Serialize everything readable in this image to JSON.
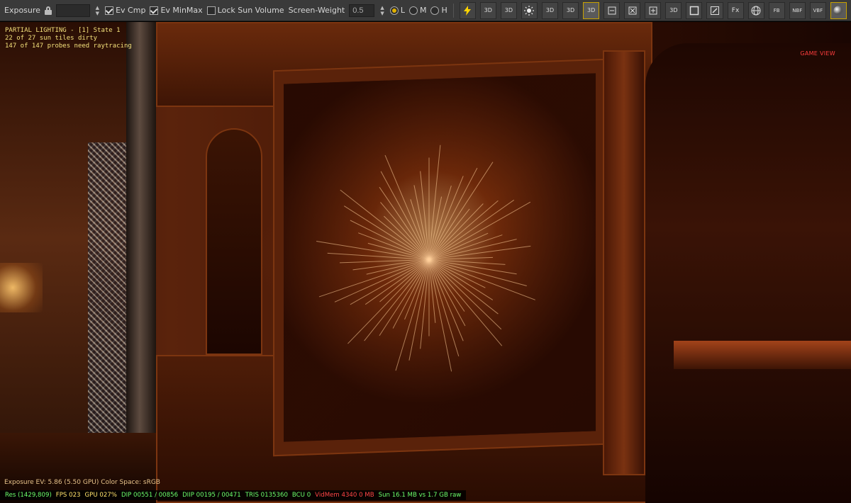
{
  "toolbar": {
    "exposure_label": "Exposure",
    "ev_cmp_label": "Ev Cmp",
    "ev_cmp_checked": true,
    "ev_minmax_label": "Ev MinMax",
    "ev_minmax_checked": true,
    "lock_sun_volume_label": "Lock Sun Volume",
    "lock_sun_volume_checked": false,
    "screen_weight_label": "Screen-Weight",
    "screen_weight_value": "0.5",
    "lod_options": [
      {
        "label": "L",
        "selected": true
      },
      {
        "label": "M",
        "selected": false
      },
      {
        "label": "H",
        "selected": false
      }
    ],
    "tool_icons": [
      {
        "name": "lightning-icon",
        "label": ""
      },
      {
        "name": "camera-3d-icon",
        "label": "3D"
      },
      {
        "name": "screen-3d-icon",
        "label": "3D"
      },
      {
        "name": "sun-icon",
        "label": ""
      },
      {
        "name": "box-3d-icon",
        "label": "3D"
      },
      {
        "name": "box2-3d-icon",
        "label": "3D"
      },
      {
        "name": "probe-3d-icon",
        "label": "3D"
      },
      {
        "name": "probe-minus-icon",
        "label": ""
      },
      {
        "name": "probe-x-icon",
        "label": ""
      },
      {
        "name": "probe-plus-icon",
        "label": ""
      },
      {
        "name": "view-3d-icon",
        "label": "3D"
      },
      {
        "name": "frame-icon",
        "label": ""
      },
      {
        "name": "edit-icon",
        "label": ""
      },
      {
        "name": "fx-icon",
        "label": "Fx"
      },
      {
        "name": "globe-icon",
        "label": ""
      },
      {
        "name": "fb-icon",
        "label": "FB"
      },
      {
        "name": "nbf-icon",
        "label": "NBF"
      },
      {
        "name": "vbf-icon",
        "label": "VBF"
      },
      {
        "name": "sphere-icon",
        "label": ""
      }
    ]
  },
  "hud": {
    "title": "PARTIAL LIGHTING - [1] State 1",
    "line2": "22 of 27 sun tiles dirty",
    "line3": "147 of 147 probes need raytracing",
    "game_view": "GAME VIEW",
    "exposure_line": "Exposure EV: 5.86 (5.50 GPU)   Color Space: sRGB"
  },
  "status": {
    "res": "Res (1429,809)",
    "fps": "FPS 023",
    "gpu": "GPU 027%",
    "dip": "DIP 00551 / 00856",
    "diip": "DIIP 00195 / 00471",
    "tris": "TRIS 0135360",
    "bcu": "BCU 0",
    "vidmem": "VidMem 4340 0 MB",
    "sun": "Sun 16.1 MB vs 1.7 GB raw"
  },
  "colors": {
    "accent": "#c8a100",
    "hud_yellow": "#f3e07a",
    "status_green": "#6cff6c",
    "status_red": "#ff4646"
  }
}
